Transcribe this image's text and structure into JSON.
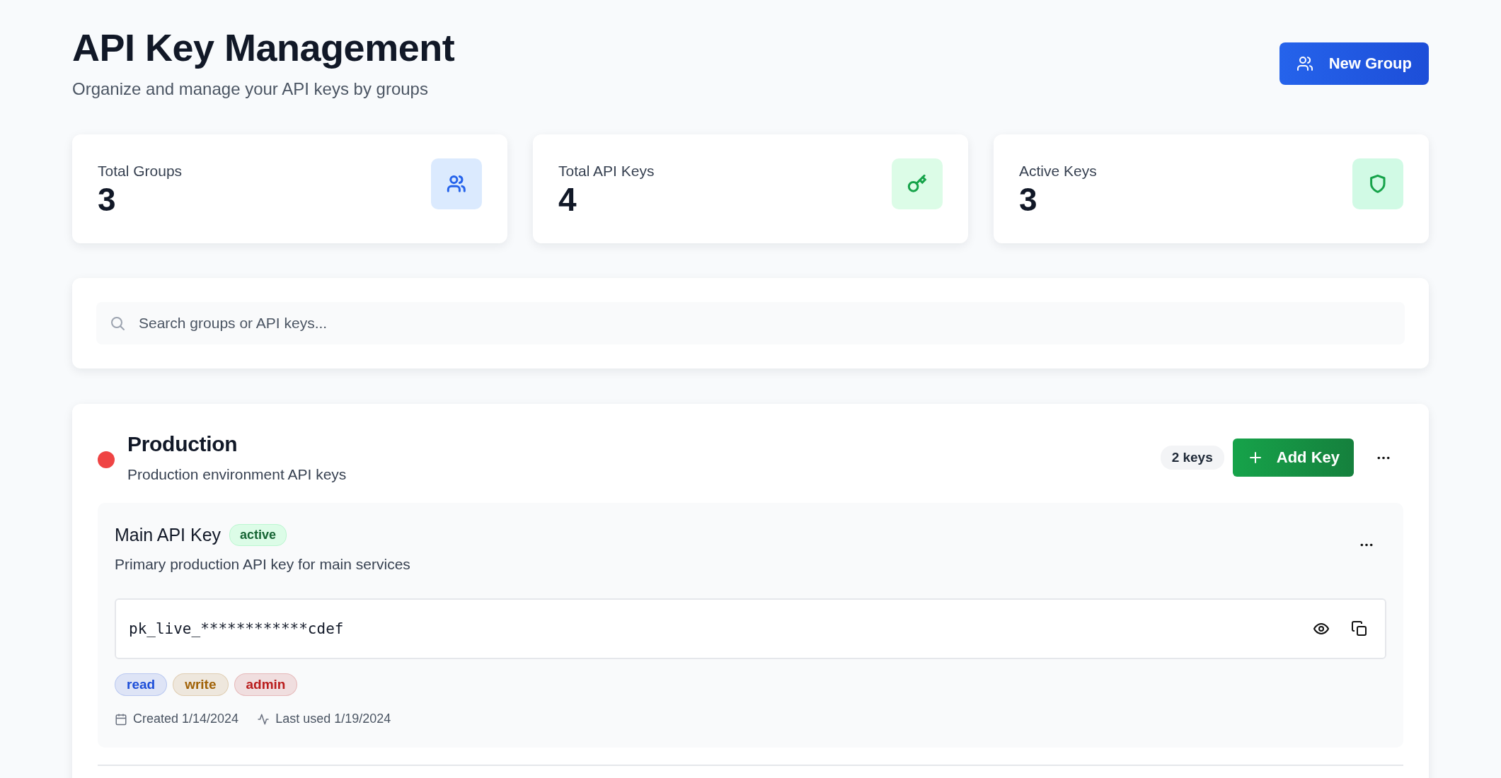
{
  "header": {
    "title": "API Key Management",
    "subtitle": "Organize and manage your API keys by groups",
    "new_group_button": "New Group"
  },
  "stats": [
    {
      "label": "Total Groups",
      "value": "3",
      "kind": "users"
    },
    {
      "label": "Total API Keys",
      "value": "4",
      "kind": "key"
    },
    {
      "label": "Active Keys",
      "value": "3",
      "kind": "shield"
    }
  ],
  "search": {
    "placeholder": "Search groups or API keys..."
  },
  "groups": [
    {
      "name": "Production",
      "description": "Production environment API keys",
      "color": "#ef4444",
      "key_count": "2 keys",
      "add_key_button": "Add Key",
      "keys": [
        {
          "name": "Main API Key",
          "status": "active",
          "description": "Primary production API key for main services",
          "masked_key": "pk_live_************cdef",
          "scopes": [
            {
              "label": "read",
              "color": "#1d4ed8"
            },
            {
              "label": "write",
              "color": "#a16207"
            },
            {
              "label": "admin",
              "color": "#b91c1c"
            }
          ],
          "created": "Created 1/14/2024",
          "last_used": "Last used 1/19/2024"
        }
      ]
    }
  ]
}
